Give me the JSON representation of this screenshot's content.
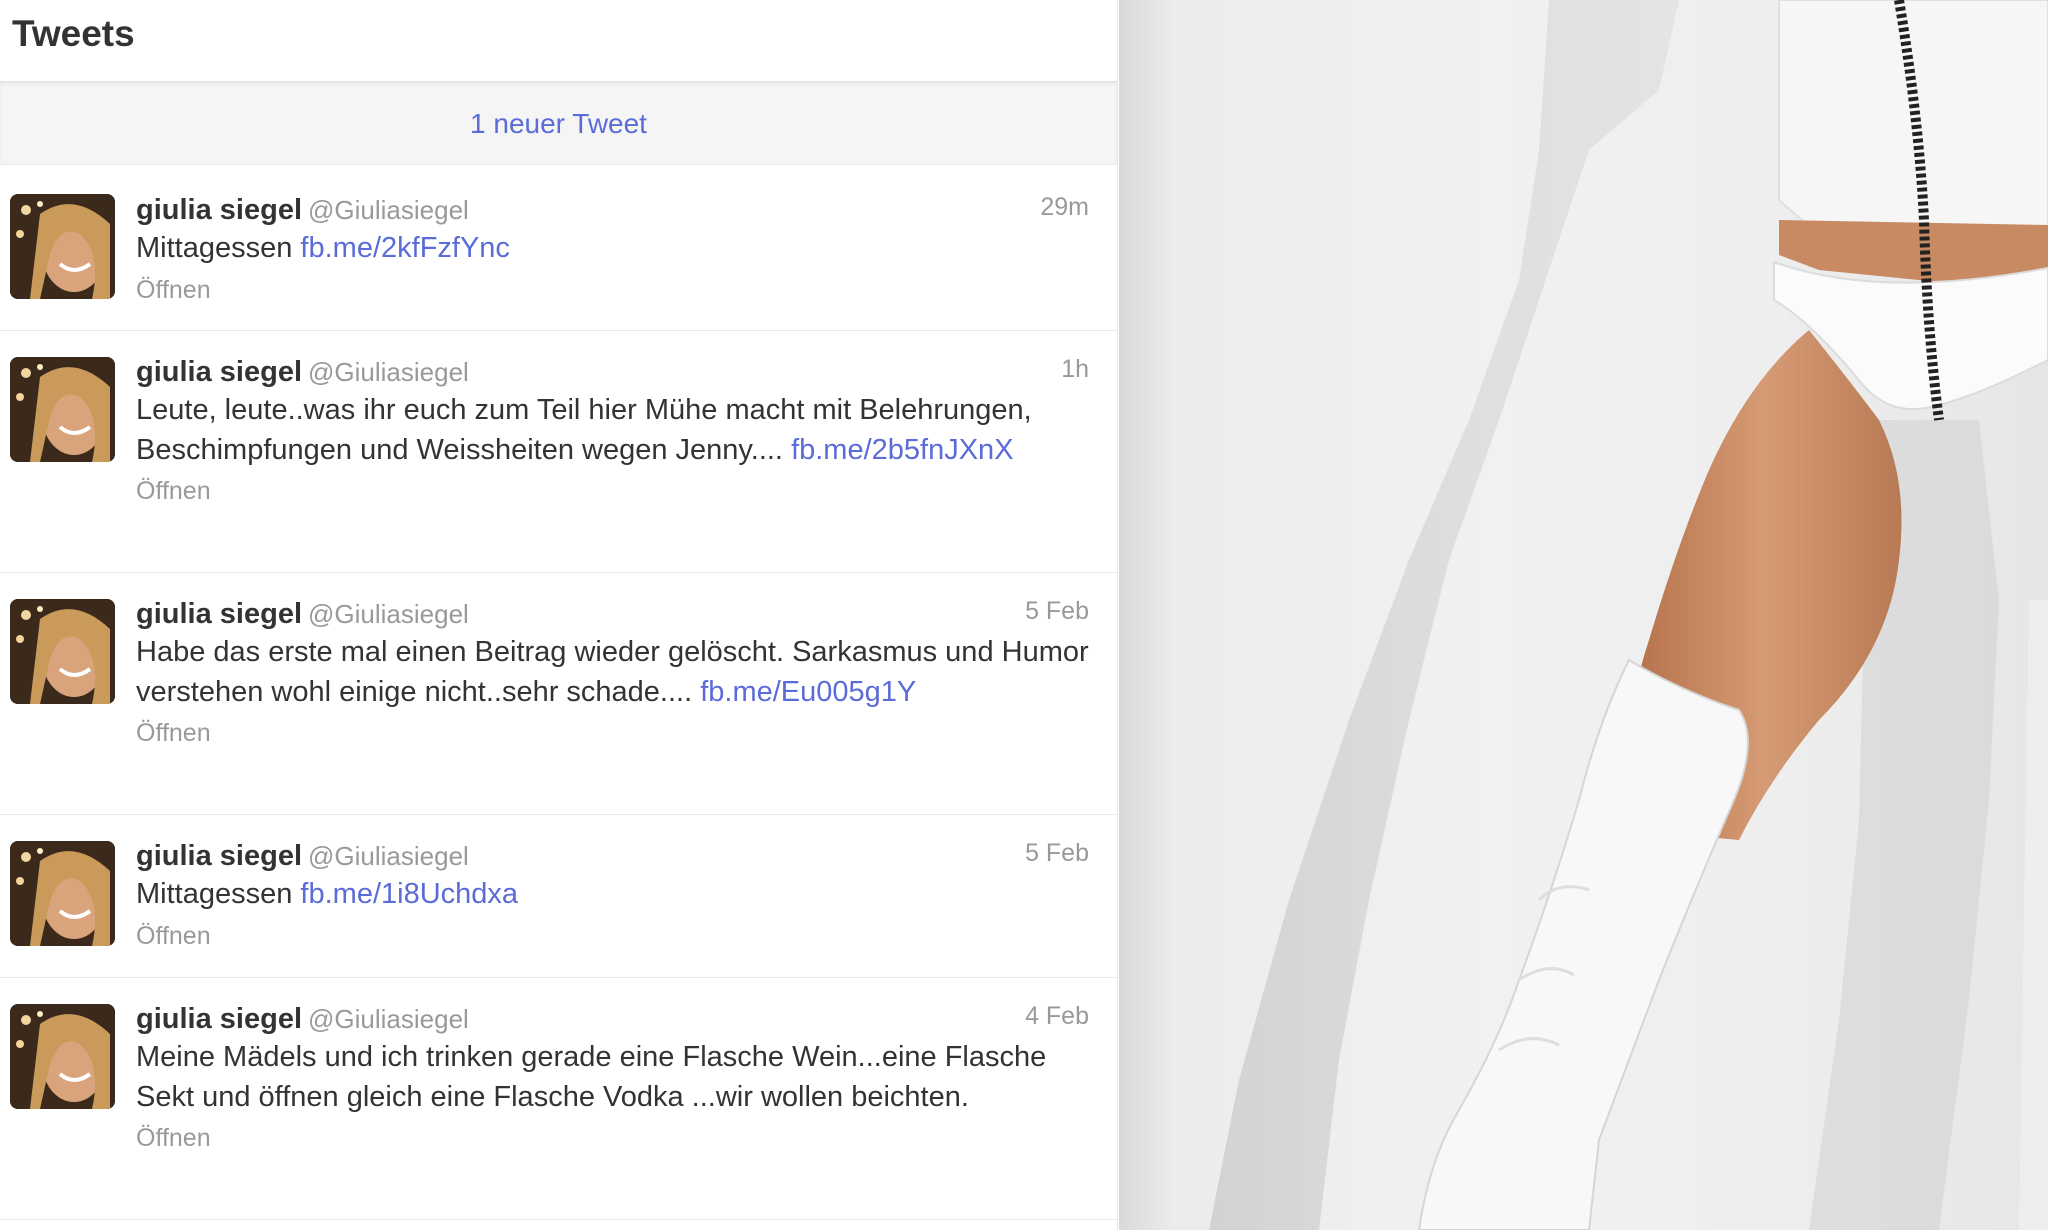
{
  "timeline": {
    "title": "Tweets",
    "new_tweets_label": "1 neuer Tweet"
  },
  "tweets": [
    {
      "fullname": "giulia siegel",
      "username": "@Giuliasiegel",
      "time": "29m",
      "text": "Mittagessen",
      "link": "fb.me/2kfFzfYnc",
      "expand": "Öffnen"
    },
    {
      "fullname": "giulia siegel",
      "username": "@Giuliasiegel",
      "time": "1h",
      "text": "Leute, leute..was ihr euch zum Teil hier Mühe macht mit Belehrungen, Beschimpfungen und Weissheiten wegen Jenny....",
      "link": "fb.me/2b5fnJXnX",
      "expand": "Öffnen"
    },
    {
      "fullname": "giulia siegel",
      "username": "@Giuliasiegel",
      "time": "5 Feb",
      "text": "Habe das erste mal einen Beitrag wieder gelöscht. Sarkasmus und Humor verstehen wohl einige nicht..sehr schade....",
      "link": "fb.me/Eu005g1Y",
      "expand": "Öffnen"
    },
    {
      "fullname": "giulia siegel",
      "username": "@Giuliasiegel",
      "time": "5 Feb",
      "text": "Mittagessen",
      "link": "fb.me/1i8Uchdxa",
      "expand": "Öffnen"
    },
    {
      "fullname": "giulia siegel",
      "username": "@Giuliasiegel",
      "time": "4 Feb",
      "text": "Meine Mädels und ich trinken gerade eine Flasche Wein...eine Flasche Sekt und öffnen gleich eine Flasche Vodka ...wir wollen beichten.",
      "link": "",
      "expand": "Öffnen"
    }
  ],
  "colors": {
    "link": "#5b6cd8",
    "text": "#333333",
    "muted": "#999999",
    "new_tweets_bg": "#f5f5f5"
  }
}
